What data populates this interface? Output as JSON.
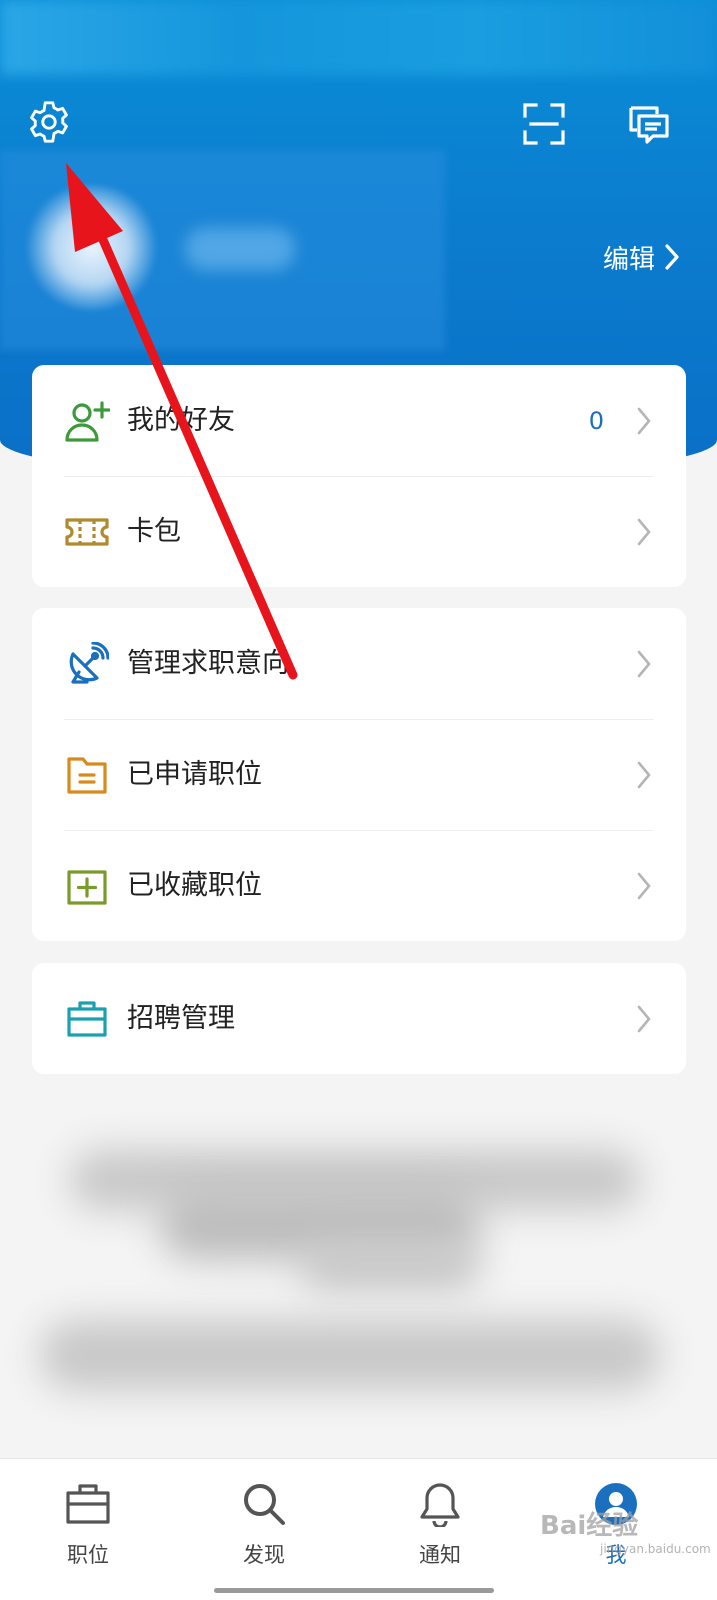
{
  "header": {
    "edit_label": "编辑"
  },
  "cards": {
    "social": [
      {
        "label": "我的好友",
        "count": "0",
        "icon": "add-friend-icon",
        "color": "#3d9a3a"
      },
      {
        "label": "卡包",
        "icon": "ticket-icon",
        "color": "#b08a2c"
      }
    ],
    "jobs": [
      {
        "label": "管理求职意向",
        "icon": "satellite-dish-icon",
        "color": "#1a6fbf"
      },
      {
        "label": "已申请职位",
        "icon": "folder-icon",
        "color": "#d88a1a"
      },
      {
        "label": "已收藏职位",
        "icon": "plus-box-icon",
        "color": "#7a9a2a"
      }
    ],
    "recruit": [
      {
        "label": "招聘管理",
        "icon": "briefcase-icon",
        "color": "#1aa0b0"
      }
    ]
  },
  "nav": {
    "items": [
      {
        "label": "职位",
        "icon": "briefcase-icon"
      },
      {
        "label": "发现",
        "icon": "search-icon"
      },
      {
        "label": "通知",
        "icon": "bell-icon"
      },
      {
        "label": "我",
        "icon": "user-avatar-icon",
        "active": true
      }
    ]
  },
  "watermark": {
    "main": "Bai经验",
    "sub": "jingyan.baidu.com"
  },
  "colors": {
    "primary": "#0b7dcf",
    "accent_text": "#1a6fbf",
    "annotation_arrow": "#e8141b"
  }
}
